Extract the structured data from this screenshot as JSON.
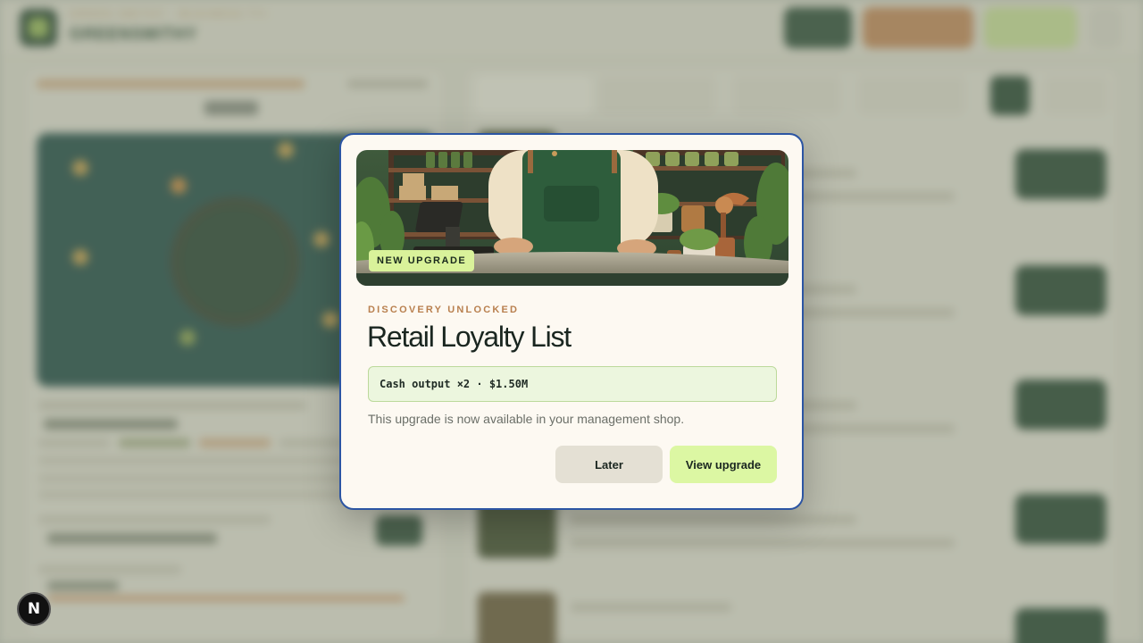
{
  "app": {
    "brand_name": "GREENSMITHY",
    "brand_subtitle": "GREEN SMITHY · BUSINESS TYCOON"
  },
  "dev_badge": {
    "label": "N"
  },
  "modal": {
    "badge": "NEW UPGRADE",
    "eyebrow": "DISCOVERY UNLOCKED",
    "title": "Retail Loyalty List",
    "effect": "Cash output ×2 · $1.50M",
    "description": "This upgrade is now available in your management shop.",
    "buttons": {
      "later": "Later",
      "view": "View upgrade"
    }
  },
  "colors": {
    "accent_border": "#2c55a3",
    "primary_dark": "#24442f",
    "lime": "#dcf7a3",
    "copper": "#b9804f"
  }
}
